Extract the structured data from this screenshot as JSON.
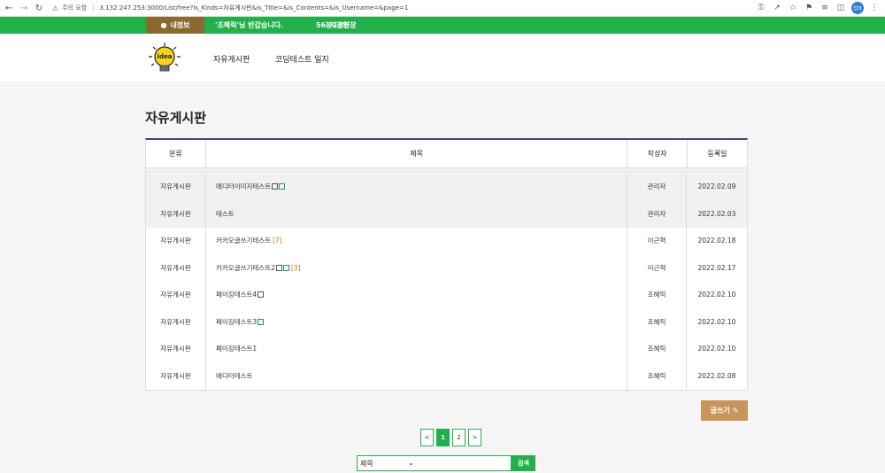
{
  "browser": {
    "security_label": "주의 요함",
    "url": "3.132.247.253:3000/List/free?is_Kinds=자유게시판&is_Title=&is_Contents=&is_Username=&page=1",
    "profile_initials": "업데"
  },
  "topbar": {
    "my_info_label": "내정보",
    "greeting": "'조혜릭'님 반갑습니다.",
    "timer": "56분23초",
    "extend_label": "시간연장",
    "color": "#22b04b"
  },
  "header": {
    "logo_text": "idea",
    "menu": [
      {
        "label": "자유게시판"
      },
      {
        "label": "코딩테스트 일지"
      }
    ]
  },
  "board": {
    "title": "자유게시판",
    "columns": {
      "category": "분류",
      "title": "제목",
      "writer": "작성자",
      "date": "등록일"
    },
    "rows": [
      {
        "category": "자유게시판",
        "title": "에디터이미지테스트",
        "comments": "",
        "writer": "관리자",
        "date": "2022.02.09",
        "notice": true,
        "icons": [
          "image",
          "doc"
        ]
      },
      {
        "category": "자유게시판",
        "title": "테스트",
        "comments": "",
        "writer": "관리자",
        "date": "2022.02.03",
        "notice": true,
        "icons": []
      },
      {
        "category": "자유게시판",
        "title": "카카오글쓰기테스트",
        "comments": "[7]",
        "writer": "이근혁",
        "date": "2022.02.18",
        "notice": false,
        "icons": []
      },
      {
        "category": "자유게시판",
        "title": "카카오글쓰기테스트2",
        "comments": "[3]",
        "writer": "이근혁",
        "date": "2022.02.17",
        "notice": false,
        "icons": [
          "image",
          "doc"
        ]
      },
      {
        "category": "자유게시판",
        "title": "페이징테스트4",
        "comments": "",
        "writer": "조혜릭",
        "date": "2022.02.10",
        "notice": false,
        "icons": [
          "image"
        ]
      },
      {
        "category": "자유게시판",
        "title": "페이징테스트3",
        "comments": "",
        "writer": "조혜릭",
        "date": "2022.02.10",
        "notice": false,
        "icons": [
          "doc"
        ]
      },
      {
        "category": "자유게시판",
        "title": "페이징테스트1",
        "comments": "",
        "writer": "조혜릭",
        "date": "2022.02.10",
        "notice": false,
        "icons": []
      },
      {
        "category": "자유게시판",
        "title": "에디터테스트",
        "comments": "",
        "writer": "조혜릭",
        "date": "2022.02.08",
        "notice": false,
        "icons": []
      }
    ]
  },
  "write_button": {
    "label": "글쓰기",
    "color": "#c8965a"
  },
  "pagination": {
    "prev": "<",
    "pages": [
      "1",
      "2"
    ],
    "current": "1",
    "next": ">"
  },
  "search": {
    "selected": "제목",
    "button_label": "검색"
  }
}
